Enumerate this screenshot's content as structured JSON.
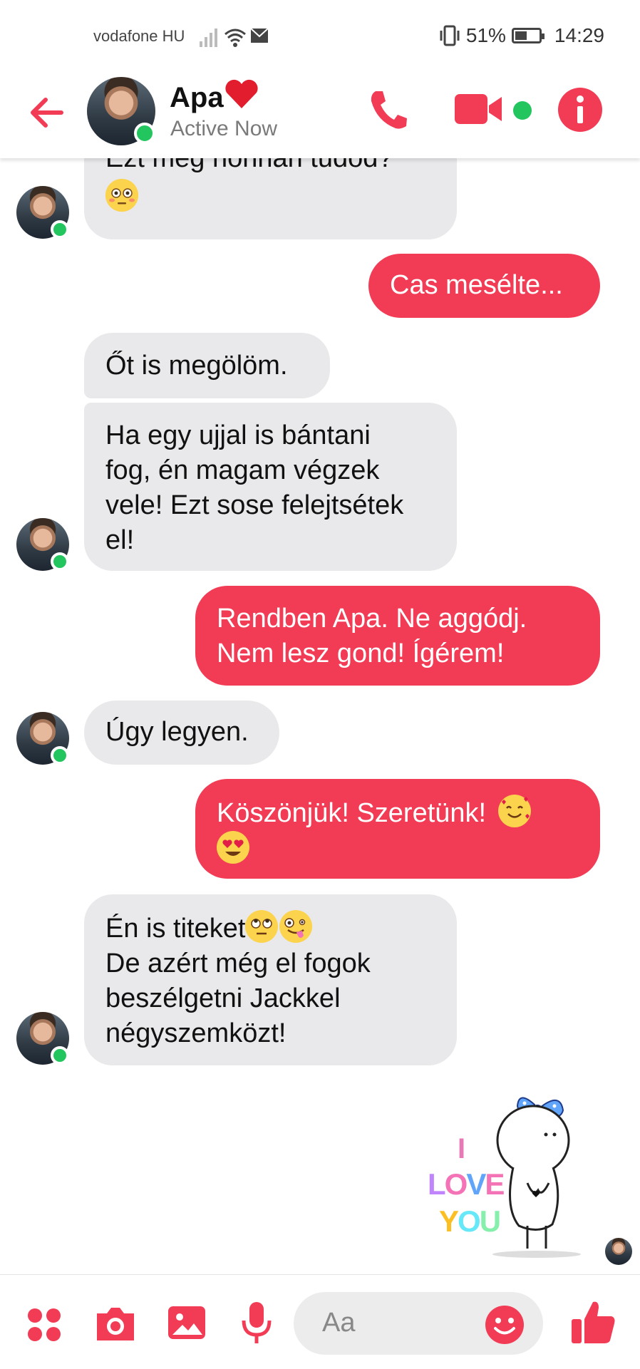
{
  "status_bar": {
    "carrier": "vodafone HU",
    "battery_percent": "51%",
    "battery_level": 0.51,
    "time": "14:29"
  },
  "header": {
    "contact_name": "Apa",
    "contact_status": "Active Now",
    "icons": [
      "back-arrow-icon",
      "phone-icon",
      "video-camera-icon",
      "online-dot",
      "info-icon"
    ]
  },
  "messages": [
    {
      "from": "contact",
      "text_line1": "Ezt meg honnan tudod?",
      "emoji": "flushed-face"
    },
    {
      "from": "me",
      "text": "Cas mesélte..."
    },
    {
      "from": "contact",
      "text": "Őt is megölöm."
    },
    {
      "from": "contact",
      "lines": [
        "Ha egy ujjal is bántani",
        "fog, én magam végzek",
        "vele! Ezt sose felejtsétek",
        "el!"
      ]
    },
    {
      "from": "me",
      "lines": [
        "Rendben Apa. Ne aggódj.",
        "Nem lesz gond! Ígérem!"
      ]
    },
    {
      "from": "contact",
      "text": "Úgy legyen."
    },
    {
      "from": "me",
      "text": "Köszönjük! Szeretünk!",
      "emojis": [
        "smiling-face-with-hearts",
        "heart-eyes"
      ]
    },
    {
      "from": "contact",
      "line1": "Én is titeket",
      "emojis": [
        "rolling-eyes",
        "zany-face"
      ],
      "lines": [
        "De azért még el fogok",
        "beszélgetni Jackkel",
        "négyszemközt!"
      ]
    }
  ],
  "sticker": {
    "word1": "I",
    "word2_letters": [
      "L",
      "O",
      "V",
      "E"
    ],
    "word3_letters": [
      "Y",
      "O",
      "U"
    ]
  },
  "composer": {
    "placeholder": "Aa",
    "icons": [
      "apps-grid-icon",
      "camera-icon",
      "gallery-icon",
      "microphone-icon",
      "emoji-icon",
      "thumbs-up-icon"
    ]
  },
  "colors": {
    "accent": "#f23c55",
    "incoming_bubble": "#e9e9eb",
    "online": "#22c55e"
  }
}
